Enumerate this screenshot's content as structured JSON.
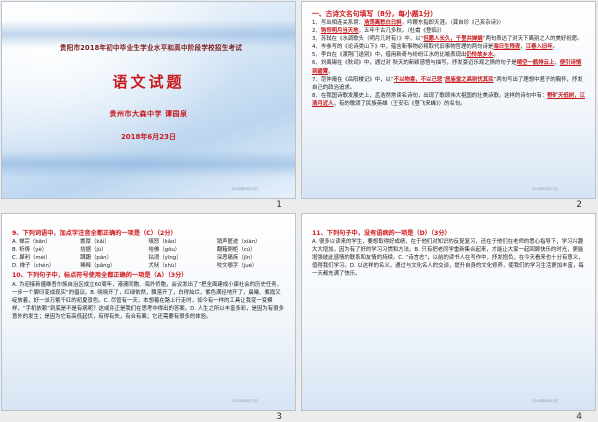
{
  "slides": [
    {
      "number": "1",
      "header": "贵阳市2018年初中毕业生学业水平和高中阶段学校招生考试",
      "title": "语文试题",
      "school": "贵州市大森中学    谭园泉",
      "date": "2018年6月23日"
    },
    {
      "number": "2",
      "section_title": "一、古诗文名句填写（8分，每小题1分）",
      "lines": [
        {
          "pre": "1、写出相连关系境：",
          "ans": "浩荡离愁白日斜",
          "post": "，吟鞭东指即天涯。（龚自珍《己亥杂诗》）"
        },
        {
          "pre": "2、",
          "ans": "钩帘明月当天地",
          "post": "，五年千古几多秋。（杜甫《登临》）"
        },
        {
          "pre": "3、苏轼在《水调歌头（明月几时有）》中，以“",
          "ans": "但愿人长久，千里共婵娟",
          "post": "”两句表达了对天下离别之人的美好祝愿。"
        },
        {
          "pre": "4、岑参写的《论诗类山下》中，蕴含新事物必将取代旧事物哲理的两句诗是",
          "ans": "海日生残夜",
          "post": "，",
          "ans2": "江春入旧年",
          "post2": "。"
        },
        {
          "pre": "5、李白在《渡荆门送别》中，借用新奇与纷纷江水的比喻表现出",
          "ans": "仍怜故乡水",
          "post": "。"
        },
        {
          "pre": "6、刘禹锡在《秋词》中，通过对 秋天的新颖感悟与描写，抒发豪迈乐观之情的句子是",
          "ans": "晴空一鹤排云上",
          "post": "，",
          "ans2": "便引诗情到碧霄",
          "post2": "。"
        },
        {
          "pre": "7、范仲淹在《岳阳楼记》中，以“",
          "ans": "不以物喜，不以己悲",
          "post": "”",
          "ans2": "居庙堂之高则忧其民",
          "post2": "”两句写出了理想中君子的胸怀，抒发自己的政治追求。"
        },
        {
          "pre": "8、在我国诗歌发展史上，孟浩然常读名诗句，出现了歌颂伟大祖国的壮美诗歌。这样的诗句中有：",
          "ans": "野旷天低树，",
          "post": "",
          "ans2": "江清月近人",
          "post2": "，有的歌颂了民族英雄（王安石《登飞来峰》）的名句。"
        }
      ]
    },
    {
      "number": "3",
      "q9_title": "9、下列词语中，加点字注音全都正确的一项是（C）（2分）",
      "q9_choices": [
        {
          "label": "A. 禅宗（bǎn）",
          "b": "憨厚（kǎi）",
          "c": "嗔怒（kǎo）",
          "d": "销声匿迹（xiàn）"
        },
        {
          "label": "B. 祈祷（yè）",
          "b": "拮据（jù）",
          "c": "哈佛（gǒu）",
          "d": "翻箱倒柜（cú）"
        },
        {
          "label": "C. 犀利（mèi）",
          "b": "蹒跚（pán）",
          "c": "拈须（yīng）",
          "d": "深恶痛疾（jīn）"
        },
        {
          "label": "D. 禅子（chén）",
          "b": "稀释（pǎng）",
          "c": "犬吠（shù）",
          "d": "咬文嚼字（jué）"
        }
      ],
      "q10_title": "10、下列句子中，标点符号使用全都正确的一项是（A）（3分）",
      "q10_text": "A. 为迎接新疆维吾尔族自治区成立60周年，港澳同胞、海外侨胞，会议发出了“把全面建成小康社会的历史任务，一步一个脚印变成现实”的倡议。B. 晓晓开了，红绿依然，飘落开了，白得灿烂，紫色满径地开了，晨曦、紫霞又绽放着，好一派万紫千红的初夏景色。C. 尽管有一天，本想着在路上行走时，如今有一样的工具让我变一变模样，“手机依赖”到底是不是有病呢？这或许正是我们在思考中得出的答案。D. 人生之所以丰富多彩，是因为有很多意外的发生；是因为它有高低起伏，有得有失，有合有离；它还需要有很多的体验。"
    },
    {
      "number": "4",
      "q11_title": "11、下列句子中，没有语病的一项是（D）（3分）",
      "q11_text": "A. 很多以读来的学生，要想取得好成绩，在于他们对知识的反复复习，还在于他们在老师的悉心指导下，学习兴趣大大增加，因为有了好的学习习惯和方法。B. 只有把老同学重新集合起来，才能让大家一起回顾快乐的时光，更能增强彼此感情的联系和友情的持续。C. “诗言志”，以前的读书人在写作中，抒发抱负，在今天看来也十分有意义，值得我们学习。D. 以这样的名义，通过与文化名人的交谈，提升自身的文化修养，使我们的学习生活更加丰富，每一天都充满了快乐。"
    }
  ],
  "footer_note": "2018年6月23日"
}
